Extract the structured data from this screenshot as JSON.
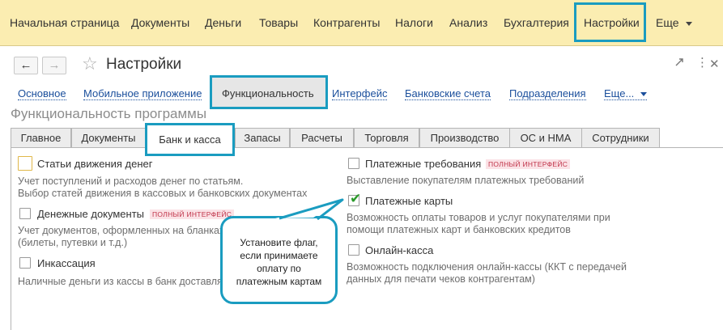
{
  "top_menu": {
    "items": [
      "Начальная страница",
      "Документы",
      "Деньги",
      "Товары",
      "Контрагенты",
      "Налоги",
      "Анализ",
      "Бухгалтерия",
      "Настройки",
      "Еще"
    ]
  },
  "window": {
    "title": "Настройки",
    "back_glyph": "←",
    "forward_glyph": "→",
    "star_glyph": "☆"
  },
  "sections": {
    "links": [
      "Основное",
      "Мобильное приложение",
      "Функциональность",
      "Интерфейс",
      "Банковские счета",
      "Подразделения",
      "Еще..."
    ],
    "active": "Функциональность"
  },
  "page_heading": "Функциональность программы",
  "tabs": [
    "Главное",
    "Документы",
    "Банк и касса",
    "Запасы",
    "Расчеты",
    "Торговля",
    "Производство",
    "ОС и НМА",
    "Сотрудники"
  ],
  "active_tab": "Банк и касса",
  "left_options": [
    {
      "label": "Статьи движения денег",
      "checked": false,
      "badge": "",
      "desc1": "Учет поступлений и расходов денег по статьям.",
      "desc2": "Выбор статей движения в кассовых и банковских документах"
    },
    {
      "label": "Денежные документы",
      "checked": false,
      "badge": "ПОЛНЫЙ ИНТЕРФЕЙС",
      "desc1": "Учет документов, оформленных на бланках",
      "desc2": "(билеты, путевки и т.д.)"
    },
    {
      "label": "Инкассация",
      "checked": false,
      "badge": "",
      "desc1": "Наличные деньги из кассы в банк доставляются",
      "desc2": ""
    }
  ],
  "right_options": [
    {
      "label": "Платежные требования",
      "checked": false,
      "badge": "ПОЛНЫЙ ИНТЕРФЕЙС",
      "desc1": "Выставление покупателям платежных требований",
      "desc2": ""
    },
    {
      "label": "Платежные карты",
      "checked": true,
      "badge": "",
      "desc1": "Возможность оплаты товаров и услуг покупателями при",
      "desc2": "помощи платежных карт и банковских кредитов"
    },
    {
      "label": "Онлайн-касса",
      "checked": false,
      "badge": "",
      "desc1": "Возможность подключения онлайн-кассы (ККТ с передачей",
      "desc2": "данных для печати чеков контрагентам)"
    }
  ],
  "callout": {
    "lines": [
      "Установите флаг,",
      "если принимаете",
      "оплату по",
      "платежным картам"
    ]
  },
  "colors": {
    "highlight": "#1a9cc0",
    "topbar": "#fbedb1",
    "link": "#1b4f9c",
    "check": "#2a9a2a",
    "badge_text": "#c0344a"
  }
}
